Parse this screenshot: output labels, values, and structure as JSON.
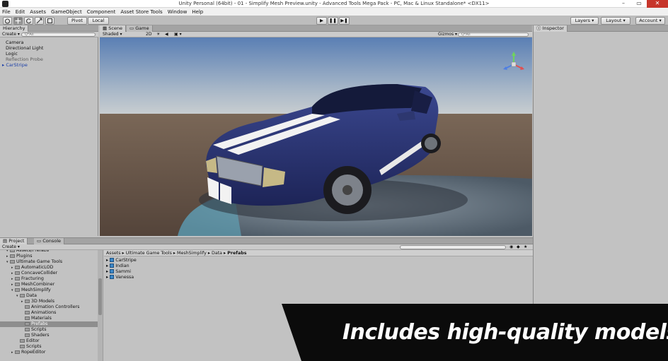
{
  "window": {
    "title": "Unity Personal (64bit) - 01 - Simplify Mesh Preview.unity - Advanced Tools Mega Pack - PC, Mac & Linux Standalone* <DX11>",
    "minimize": "–",
    "maximize": "▭",
    "close": "✕"
  },
  "menu": [
    "File",
    "Edit",
    "Assets",
    "GameObject",
    "Component",
    "Asset Store Tools",
    "Window",
    "Help"
  ],
  "toolbar": {
    "pivot": "Pivot",
    "local": "Local",
    "play": "▶",
    "pause": "❚❚",
    "step": "▶❚",
    "layers": "Layers",
    "layout": "Layout",
    "account": "Account"
  },
  "hierarchy": {
    "tab": "Hierarchy",
    "create": "Create",
    "search_placeholder": "Q*All",
    "items": [
      {
        "label": "Camera"
      },
      {
        "label": "Directional Light"
      },
      {
        "label": "Logic"
      },
      {
        "label": "Reflection Probe"
      },
      {
        "label": "CarStripe"
      }
    ]
  },
  "scene": {
    "tab_scene": "Scene",
    "tab_game": "Game",
    "shading": "Shaded",
    "mode_2d": "2D",
    "gizmos": "Gizmos",
    "search_placeholder": "Q*All"
  },
  "inspector": {
    "tab": "Inspector"
  },
  "project": {
    "tab_project": "Project",
    "tab_console": "Console",
    "create": "Create",
    "tree": [
      {
        "label": "Assets/Prefabs",
        "depth": 1,
        "expanded": true,
        "cut": true
      },
      {
        "label": "Plugins",
        "depth": 1,
        "expanded": false
      },
      {
        "label": "Ultimate Game Tools",
        "depth": 1,
        "expanded": true
      },
      {
        "label": "AutomaticLOD",
        "depth": 2,
        "expanded": false
      },
      {
        "label": "ConcaveCollider",
        "depth": 2,
        "expanded": false
      },
      {
        "label": "Fracturing",
        "depth": 2,
        "expanded": false
      },
      {
        "label": "MeshCombiner",
        "depth": 2,
        "expanded": false
      },
      {
        "label": "MeshSimplify",
        "depth": 2,
        "expanded": true
      },
      {
        "label": "Data",
        "depth": 3,
        "expanded": true
      },
      {
        "label": "3D Models",
        "depth": 4,
        "expanded": false
      },
      {
        "label": "Animation Controllers",
        "depth": 4,
        "expanded": null
      },
      {
        "label": "Animations",
        "depth": 4,
        "expanded": null
      },
      {
        "label": "Materials",
        "depth": 4,
        "expanded": null
      },
      {
        "label": "Prefabs",
        "depth": 4,
        "expanded": null,
        "selected": true
      },
      {
        "label": "Scripts",
        "depth": 4,
        "expanded": null
      },
      {
        "label": "Shaders",
        "depth": 4,
        "expanded": null
      },
      {
        "label": "Editor",
        "depth": 3,
        "expanded": null
      },
      {
        "label": "Scripts",
        "depth": 3,
        "expanded": null
      },
      {
        "label": "RopeEditor",
        "depth": 2,
        "expanded": false
      }
    ],
    "breadcrumb": [
      "Assets",
      "Ultimate Game Tools",
      "MeshSimplify",
      "Data",
      "Prefabs"
    ],
    "files": [
      "CarStripe",
      "Indian",
      "Sammi",
      "Vanessa"
    ]
  },
  "banner": {
    "text": "Includes high-quality models"
  },
  "colors": {
    "car_body": "#2b3576",
    "stripe": "#f2f2f2",
    "sky_top": "#5a7fb4",
    "ground": "#6e5b4c",
    "banner_bg": "#0b0b0b"
  }
}
